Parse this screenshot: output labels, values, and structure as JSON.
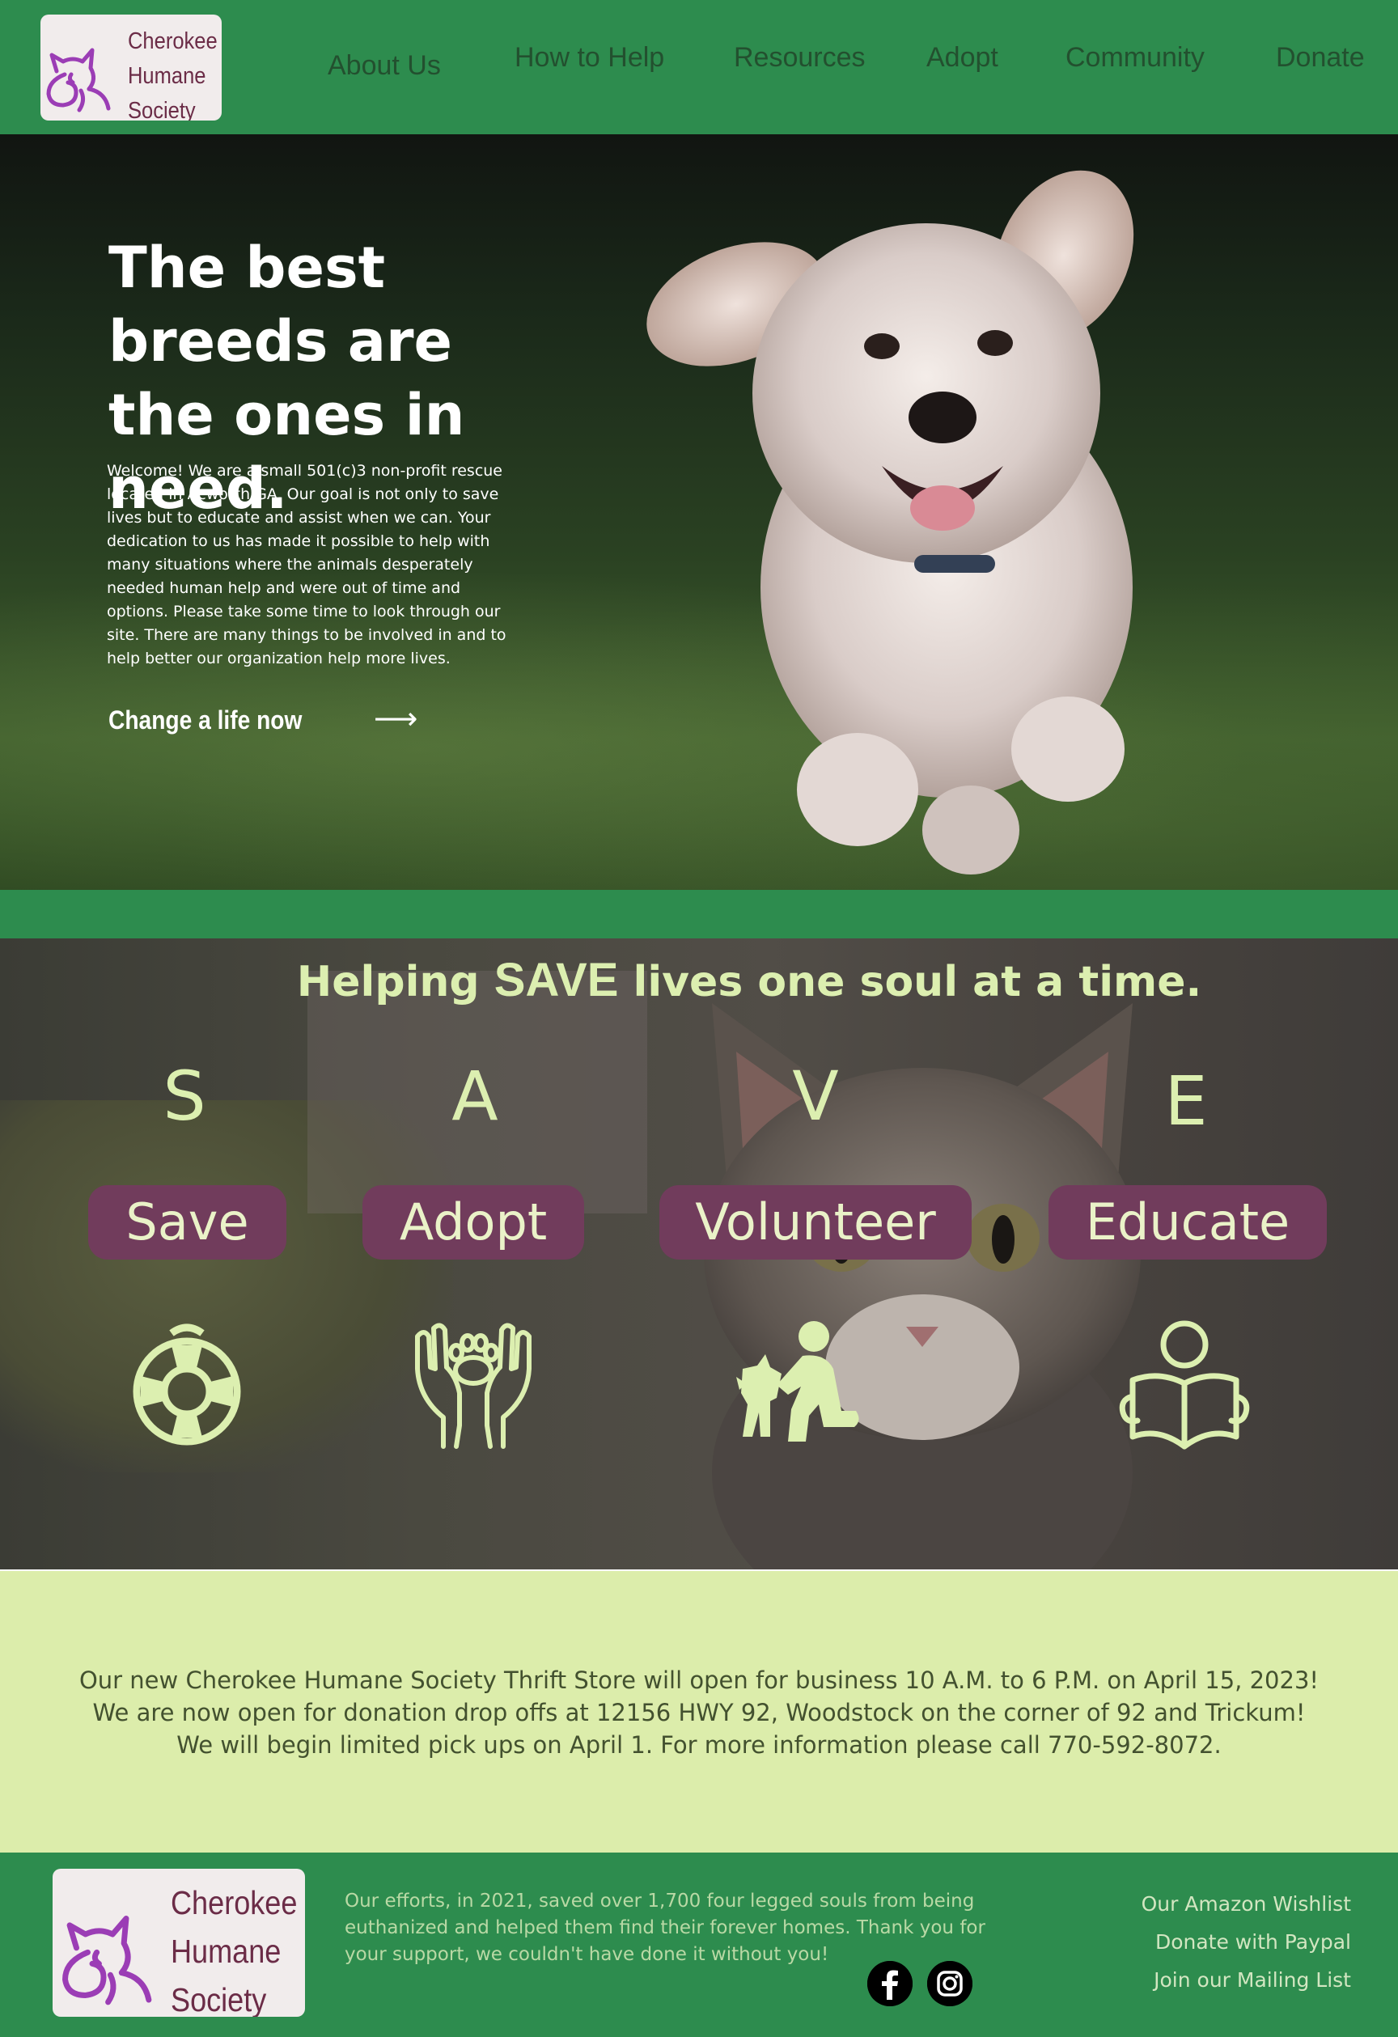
{
  "header": {
    "logo_lines": [
      "Cherokee",
      "Humane",
      "Society"
    ],
    "nav": [
      "About Us",
      "How to Help",
      "Resources",
      "Adopt",
      "Community",
      "Donate"
    ]
  },
  "hero": {
    "title": "The best breeds are the ones in need.",
    "body": "Welcome! We are a small 501(c)3 non-profit rescue located in Acworth GA. Our goal is not only to save lives but to educate and assist when we can. Your dedication to us has made it possible to help with many situations where the animals desperately needed human help and were out of time and options. Please take some time to look through our site. There are many things to be involved in and to help better our organization help more lives.",
    "cta": "Change a life now",
    "cta_arrow": "⟶"
  },
  "save": {
    "title_pre": "Helping ",
    "title_big": "SAVE",
    "title_post": " lives one soul at a time.",
    "items": [
      {
        "letter": "S",
        "label": "Save",
        "icon": "lifebuoy-icon"
      },
      {
        "letter": "A",
        "label": "Adopt",
        "icon": "paw-hands-icon"
      },
      {
        "letter": "V",
        "label": "Volunteer",
        "icon": "person-with-dog-icon"
      },
      {
        "letter": "E",
        "label": "Educate",
        "icon": "reading-person-icon"
      }
    ]
  },
  "announcement": {
    "lines": [
      "Our new Cherokee Humane Society Thrift Store will open for business 10 A.M. to 6 P.M. on April 15, 2023!",
      "We are now open for donation drop offs at 12156 HWY 92, Woodstock on the corner of 92 and Trickum!",
      "We will begin limited pick ups on April 1. For more information please call 770-592-8072."
    ]
  },
  "footer": {
    "logo_lines": [
      "Cherokee",
      "Humane",
      "Society"
    ],
    "text": "Our efforts, in 2021, saved over 1,700 four legged souls from being euthanized and helped them find their forever homes. Thank you for your support, we couldn't have done it without you!",
    "social": [
      "facebook-icon",
      "instagram-icon"
    ],
    "links": [
      "Our Amazon Wishlist",
      "Donate with Paypal",
      "Join our Mailing List"
    ]
  },
  "colors": {
    "brand_green": "#2d8c4e",
    "accent_lime": "#dcefb0",
    "pill_plum": "#713c5c",
    "logo_purple": "#9b3db5",
    "announce_bg": "#dcedab"
  }
}
